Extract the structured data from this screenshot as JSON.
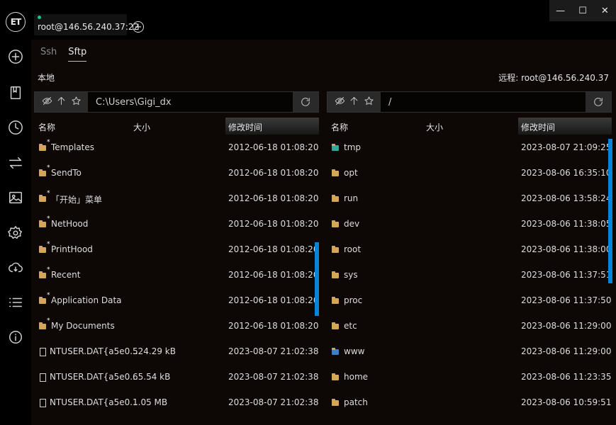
{
  "app": {
    "logo": "ET",
    "tab_label": "root@146.56.240.37:22",
    "add_tab_symbol": "+",
    "window_controls": [
      "—",
      "☐",
      "✕"
    ]
  },
  "rail_icons": [
    "plus-circle-icon",
    "bookmark-icon",
    "clock-icon",
    "transfer-icon",
    "image-icon",
    "gear-icon",
    "cloud-sync-icon",
    "list-icon",
    "info-icon"
  ],
  "subtabs": [
    "Ssh",
    "Sftp"
  ],
  "local": {
    "label": "本地",
    "path": "C:\\Users\\Gigi_dx",
    "columns": [
      "名称",
      "大小",
      "修改时间"
    ],
    "rows": [
      {
        "type": "folder",
        "link": true,
        "name": "Templates",
        "size": "",
        "time": "2012-06-18 01:08:20"
      },
      {
        "type": "folder",
        "link": true,
        "name": "SendTo",
        "size": "",
        "time": "2012-06-18 01:08:20"
      },
      {
        "type": "folder",
        "link": true,
        "name": "「开始」菜单",
        "size": "",
        "time": "2012-06-18 01:08:20"
      },
      {
        "type": "folder",
        "link": true,
        "name": "NetHood",
        "size": "",
        "time": "2012-06-18 01:08:20"
      },
      {
        "type": "folder",
        "link": true,
        "name": "PrintHood",
        "size": "",
        "time": "2012-06-18 01:08:20"
      },
      {
        "type": "folder",
        "link": true,
        "name": "Recent",
        "size": "",
        "time": "2012-06-18 01:08:20"
      },
      {
        "type": "folder",
        "link": true,
        "name": "Application Data",
        "size": "",
        "time": "2012-06-18 01:08:20"
      },
      {
        "type": "folder",
        "link": true,
        "name": "My Documents",
        "size": "",
        "time": "2012-06-18 01:08:20"
      },
      {
        "type": "file",
        "link": false,
        "name": "NTUSER.DAT{a5e0...",
        "size": "524.29 kB",
        "time": "2023-08-07 21:02:38"
      },
      {
        "type": "file",
        "link": false,
        "name": "NTUSER.DAT{a5e0...",
        "size": "65.54 kB",
        "time": "2023-08-07 21:02:38"
      },
      {
        "type": "file",
        "link": false,
        "name": "NTUSER.DAT{a5e0...",
        "size": "1.05 MB",
        "time": "2023-08-07 21:02:38"
      }
    ]
  },
  "remote": {
    "label": "远程: root@146.56.240.37",
    "path": "/",
    "columns": [
      "名称",
      "大小",
      "修改时间"
    ],
    "rows": [
      {
        "type": "folder-special",
        "name": "tmp",
        "size": "",
        "time": "2023-08-07 21:09:25"
      },
      {
        "type": "folder",
        "name": "opt",
        "size": "",
        "time": "2023-08-06 16:35:10"
      },
      {
        "type": "folder",
        "name": "run",
        "size": "",
        "time": "2023-08-06 13:58:24"
      },
      {
        "type": "folder",
        "name": "dev",
        "size": "",
        "time": "2023-08-06 11:38:05"
      },
      {
        "type": "folder",
        "name": "root",
        "size": "",
        "time": "2023-08-06 11:38:00"
      },
      {
        "type": "folder",
        "name": "sys",
        "size": "",
        "time": "2023-08-06 11:37:51"
      },
      {
        "type": "folder",
        "name": "proc",
        "size": "",
        "time": "2023-08-06 11:37:50"
      },
      {
        "type": "folder",
        "name": "etc",
        "size": "",
        "time": "2023-08-06 11:29:00"
      },
      {
        "type": "folder-special",
        "name": "www",
        "size": "",
        "time": "2023-08-06 11:29:00"
      },
      {
        "type": "folder",
        "name": "home",
        "size": "",
        "time": "2023-08-06 11:23:35"
      },
      {
        "type": "folder",
        "name": "patch",
        "size": "",
        "time": "2023-08-06 10:59:51"
      }
    ]
  },
  "colors": {
    "accent": "#0a84d6",
    "folder": "#d5a55a",
    "online": "#19c48a"
  }
}
